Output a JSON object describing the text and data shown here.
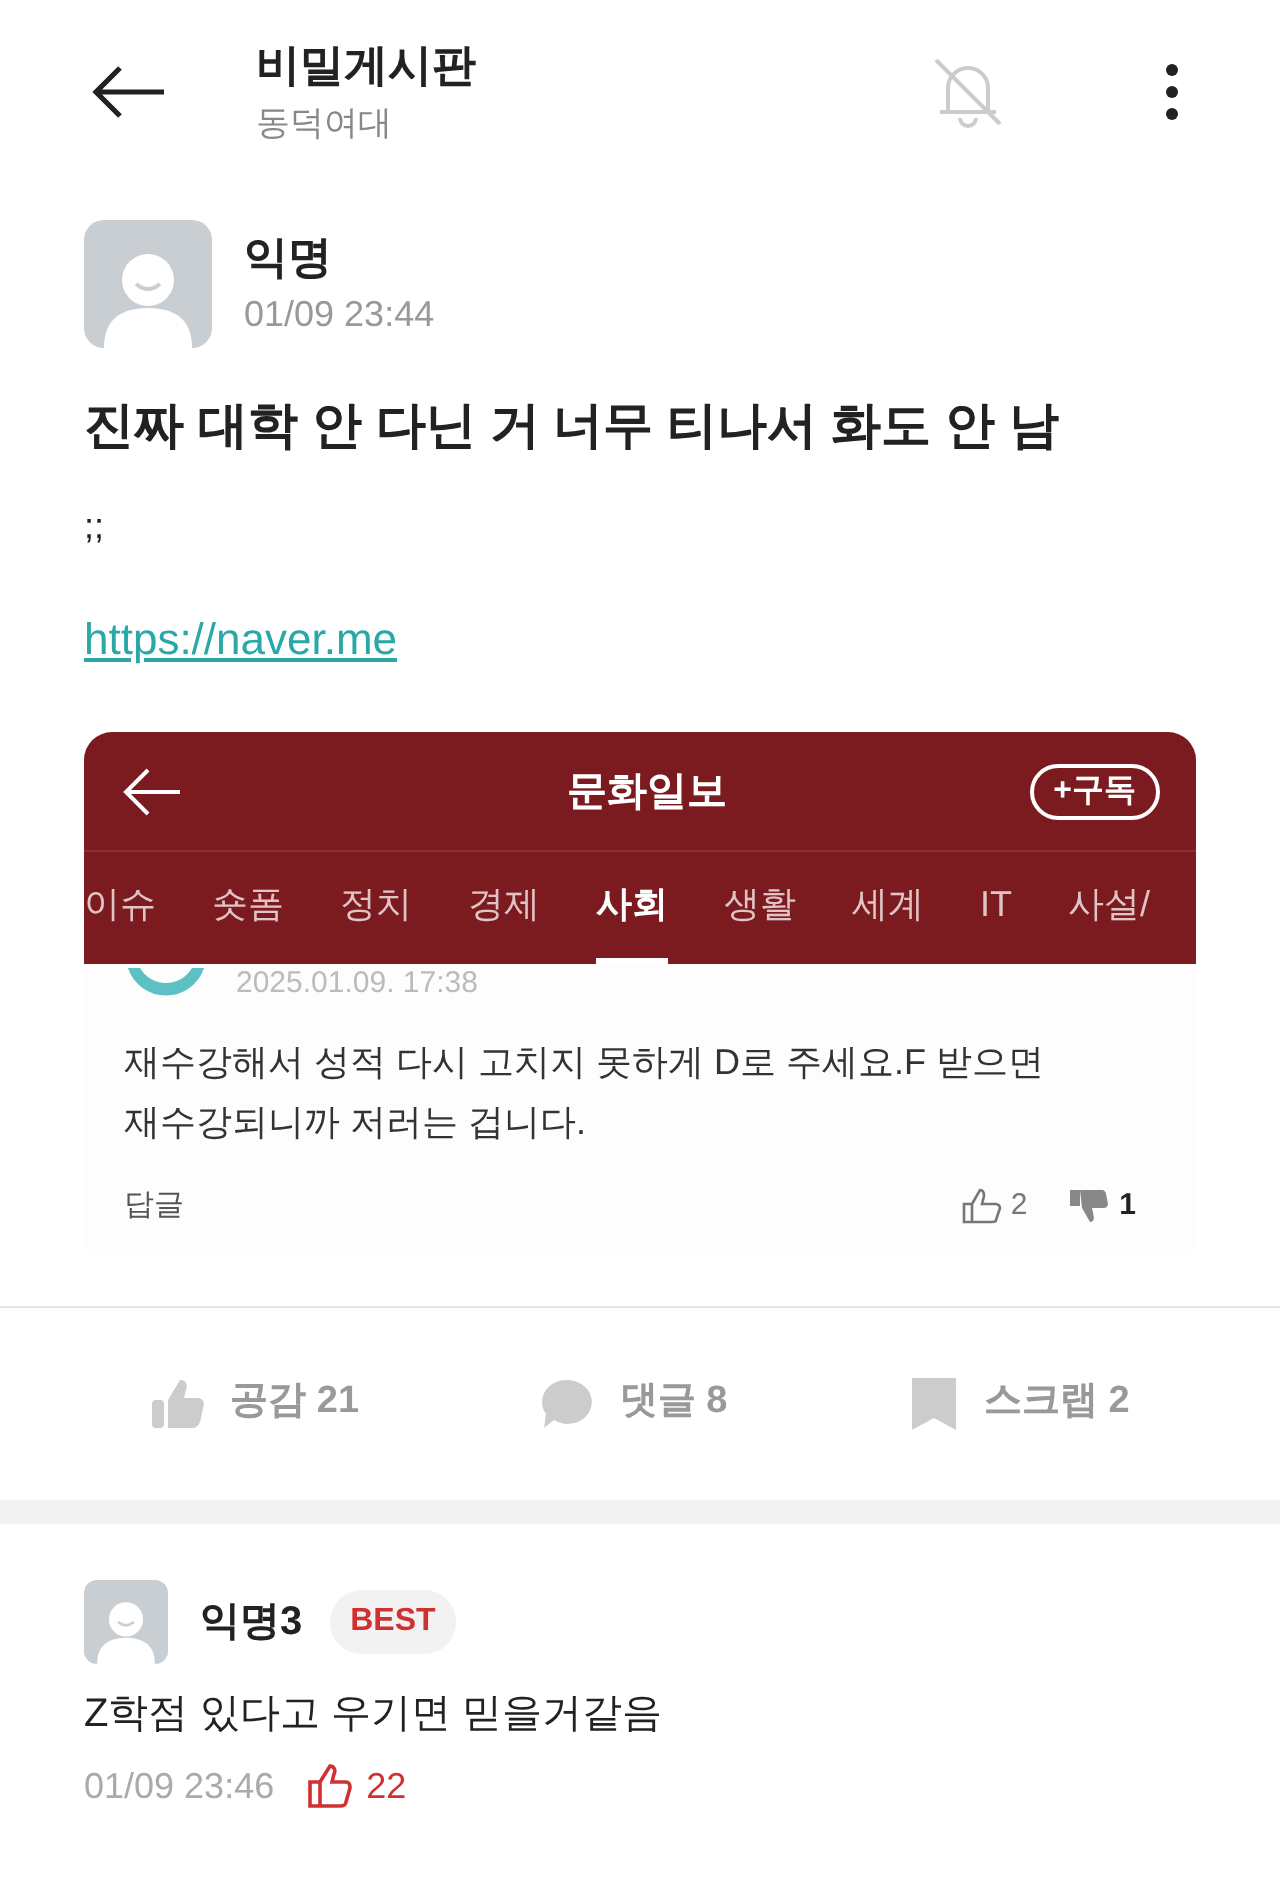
{
  "header": {
    "title": "비밀게시판",
    "subtitle": "동덕여대",
    "notifications_on": false
  },
  "post": {
    "author": "익명",
    "time": "01/09 23:44",
    "title": "진짜 대학 안 다닌 거 너무 티나서 화도 안 남",
    "body": ";;",
    "link": "https://naver.me"
  },
  "embed": {
    "title": "문화일보",
    "subscribe": "+구독",
    "tabs": [
      {
        "label": "이슈",
        "selected": false
      },
      {
        "label": "숏폼",
        "selected": false
      },
      {
        "label": "정치",
        "selected": false
      },
      {
        "label": "경제",
        "selected": false
      },
      {
        "label": "사회",
        "selected": true
      },
      {
        "label": "생활",
        "selected": false
      },
      {
        "label": "세계",
        "selected": false
      },
      {
        "label": "IT",
        "selected": false
      },
      {
        "label": "사설/",
        "selected": false
      }
    ],
    "comment": {
      "time": "2025.01.09. 17:38",
      "text": "재수강해서 성적 다시 고치지 못하게 D로 주세요.F 받으면 재수강되니까 저러는 겁니다.",
      "reply": "답글",
      "likes": "2",
      "dislikes": "1"
    }
  },
  "actions": [
    {
      "kind": "like",
      "label": "공감 21"
    },
    {
      "kind": "comment",
      "label": "댓글 8"
    },
    {
      "kind": "scrap",
      "label": "스크랩 2"
    }
  ],
  "comments": [
    {
      "author": "익명3",
      "best": true,
      "best_label": "BEST",
      "text": "Z학점 있다고 우기면 믿을거같음",
      "time": "01/09 23:46",
      "likes": "22"
    }
  ]
}
